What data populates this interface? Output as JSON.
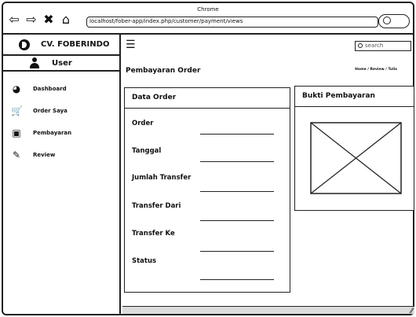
{
  "browser": {
    "title": "Chrome",
    "url": "localhost/fober-app/index.php/customer/payment/views",
    "nav": {
      "back": "⇦",
      "forward": "⇨",
      "close": "✖",
      "home": "⌂"
    }
  },
  "sidebar": {
    "brand": "CV. FOBERINDO",
    "user": "User",
    "items": [
      {
        "label": "Dashboard",
        "icon": "dashboard-icon",
        "glyph": "◕"
      },
      {
        "label": "Order Saya",
        "icon": "cart-icon",
        "glyph": "🛒"
      },
      {
        "label": "Pembayaran",
        "icon": "money-icon",
        "glyph": "▣"
      },
      {
        "label": "Review",
        "icon": "edit-icon",
        "glyph": "✎"
      }
    ]
  },
  "header": {
    "search_placeholder": "search",
    "page_title": "Pembayaran Order",
    "breadcrumb": "Home / Review / Tulis"
  },
  "order_card": {
    "title": "Data Order",
    "fields": [
      "Order",
      "Tanggal",
      "Jumlah Transfer",
      "Transfer Dari",
      "Transfer Ke",
      "Status"
    ]
  },
  "bukti_card": {
    "title": "Bukti Pembayaran"
  }
}
